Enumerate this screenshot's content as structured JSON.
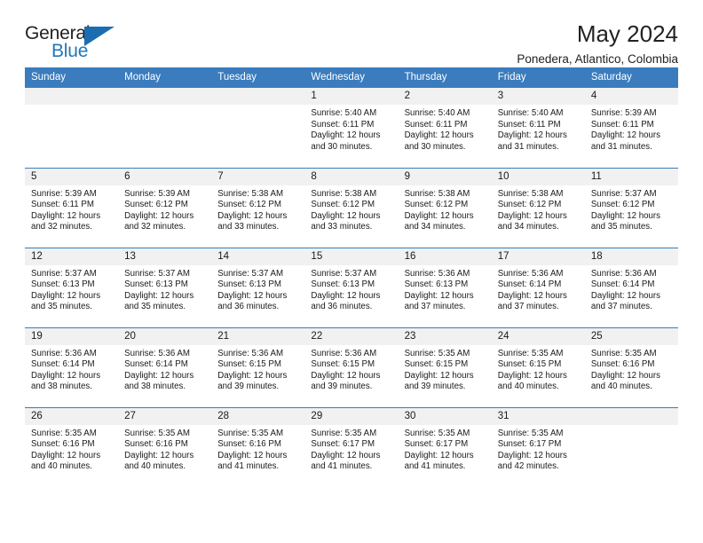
{
  "brand": {
    "word_one": "General",
    "word_two": "Blue",
    "triangle_icon": "triangle-icon"
  },
  "header": {
    "title": "May 2024",
    "location": "Ponedera, Atlantico, Colombia"
  },
  "colors": {
    "header_blue": "#3a7cbe",
    "brand_blue": "#2077bc",
    "daynum_gray": "#f1f1f1"
  },
  "weekday_headers": [
    "Sunday",
    "Monday",
    "Tuesday",
    "Wednesday",
    "Thursday",
    "Friday",
    "Saturday"
  ],
  "labels": {
    "sunrise_prefix": "Sunrise:",
    "sunset_prefix": "Sunset:",
    "daylight_prefix": "Daylight:"
  },
  "weeks": [
    [
      {
        "day": "",
        "empty": true
      },
      {
        "day": "",
        "empty": true
      },
      {
        "day": "",
        "empty": true
      },
      {
        "day": "1",
        "sunrise": "Sunrise: 5:40 AM",
        "sunset": "Sunset: 6:11 PM",
        "daylight_line1": "Daylight: 12 hours",
        "daylight_line2": "and 30 minutes."
      },
      {
        "day": "2",
        "sunrise": "Sunrise: 5:40 AM",
        "sunset": "Sunset: 6:11 PM",
        "daylight_line1": "Daylight: 12 hours",
        "daylight_line2": "and 30 minutes."
      },
      {
        "day": "3",
        "sunrise": "Sunrise: 5:40 AM",
        "sunset": "Sunset: 6:11 PM",
        "daylight_line1": "Daylight: 12 hours",
        "daylight_line2": "and 31 minutes."
      },
      {
        "day": "4",
        "sunrise": "Sunrise: 5:39 AM",
        "sunset": "Sunset: 6:11 PM",
        "daylight_line1": "Daylight: 12 hours",
        "daylight_line2": "and 31 minutes."
      }
    ],
    [
      {
        "day": "5",
        "sunrise": "Sunrise: 5:39 AM",
        "sunset": "Sunset: 6:11 PM",
        "daylight_line1": "Daylight: 12 hours",
        "daylight_line2": "and 32 minutes."
      },
      {
        "day": "6",
        "sunrise": "Sunrise: 5:39 AM",
        "sunset": "Sunset: 6:12 PM",
        "daylight_line1": "Daylight: 12 hours",
        "daylight_line2": "and 32 minutes."
      },
      {
        "day": "7",
        "sunrise": "Sunrise: 5:38 AM",
        "sunset": "Sunset: 6:12 PM",
        "daylight_line1": "Daylight: 12 hours",
        "daylight_line2": "and 33 minutes."
      },
      {
        "day": "8",
        "sunrise": "Sunrise: 5:38 AM",
        "sunset": "Sunset: 6:12 PM",
        "daylight_line1": "Daylight: 12 hours",
        "daylight_line2": "and 33 minutes."
      },
      {
        "day": "9",
        "sunrise": "Sunrise: 5:38 AM",
        "sunset": "Sunset: 6:12 PM",
        "daylight_line1": "Daylight: 12 hours",
        "daylight_line2": "and 34 minutes."
      },
      {
        "day": "10",
        "sunrise": "Sunrise: 5:38 AM",
        "sunset": "Sunset: 6:12 PM",
        "daylight_line1": "Daylight: 12 hours",
        "daylight_line2": "and 34 minutes."
      },
      {
        "day": "11",
        "sunrise": "Sunrise: 5:37 AM",
        "sunset": "Sunset: 6:12 PM",
        "daylight_line1": "Daylight: 12 hours",
        "daylight_line2": "and 35 minutes."
      }
    ],
    [
      {
        "day": "12",
        "sunrise": "Sunrise: 5:37 AM",
        "sunset": "Sunset: 6:13 PM",
        "daylight_line1": "Daylight: 12 hours",
        "daylight_line2": "and 35 minutes."
      },
      {
        "day": "13",
        "sunrise": "Sunrise: 5:37 AM",
        "sunset": "Sunset: 6:13 PM",
        "daylight_line1": "Daylight: 12 hours",
        "daylight_line2": "and 35 minutes."
      },
      {
        "day": "14",
        "sunrise": "Sunrise: 5:37 AM",
        "sunset": "Sunset: 6:13 PM",
        "daylight_line1": "Daylight: 12 hours",
        "daylight_line2": "and 36 minutes."
      },
      {
        "day": "15",
        "sunrise": "Sunrise: 5:37 AM",
        "sunset": "Sunset: 6:13 PM",
        "daylight_line1": "Daylight: 12 hours",
        "daylight_line2": "and 36 minutes."
      },
      {
        "day": "16",
        "sunrise": "Sunrise: 5:36 AM",
        "sunset": "Sunset: 6:13 PM",
        "daylight_line1": "Daylight: 12 hours",
        "daylight_line2": "and 37 minutes."
      },
      {
        "day": "17",
        "sunrise": "Sunrise: 5:36 AM",
        "sunset": "Sunset: 6:14 PM",
        "daylight_line1": "Daylight: 12 hours",
        "daylight_line2": "and 37 minutes."
      },
      {
        "day": "18",
        "sunrise": "Sunrise: 5:36 AM",
        "sunset": "Sunset: 6:14 PM",
        "daylight_line1": "Daylight: 12 hours",
        "daylight_line2": "and 37 minutes."
      }
    ],
    [
      {
        "day": "19",
        "sunrise": "Sunrise: 5:36 AM",
        "sunset": "Sunset: 6:14 PM",
        "daylight_line1": "Daylight: 12 hours",
        "daylight_line2": "and 38 minutes."
      },
      {
        "day": "20",
        "sunrise": "Sunrise: 5:36 AM",
        "sunset": "Sunset: 6:14 PM",
        "daylight_line1": "Daylight: 12 hours",
        "daylight_line2": "and 38 minutes."
      },
      {
        "day": "21",
        "sunrise": "Sunrise: 5:36 AM",
        "sunset": "Sunset: 6:15 PM",
        "daylight_line1": "Daylight: 12 hours",
        "daylight_line2": "and 39 minutes."
      },
      {
        "day": "22",
        "sunrise": "Sunrise: 5:36 AM",
        "sunset": "Sunset: 6:15 PM",
        "daylight_line1": "Daylight: 12 hours",
        "daylight_line2": "and 39 minutes."
      },
      {
        "day": "23",
        "sunrise": "Sunrise: 5:35 AM",
        "sunset": "Sunset: 6:15 PM",
        "daylight_line1": "Daylight: 12 hours",
        "daylight_line2": "and 39 minutes."
      },
      {
        "day": "24",
        "sunrise": "Sunrise: 5:35 AM",
        "sunset": "Sunset: 6:15 PM",
        "daylight_line1": "Daylight: 12 hours",
        "daylight_line2": "and 40 minutes."
      },
      {
        "day": "25",
        "sunrise": "Sunrise: 5:35 AM",
        "sunset": "Sunset: 6:16 PM",
        "daylight_line1": "Daylight: 12 hours",
        "daylight_line2": "and 40 minutes."
      }
    ],
    [
      {
        "day": "26",
        "sunrise": "Sunrise: 5:35 AM",
        "sunset": "Sunset: 6:16 PM",
        "daylight_line1": "Daylight: 12 hours",
        "daylight_line2": "and 40 minutes."
      },
      {
        "day": "27",
        "sunrise": "Sunrise: 5:35 AM",
        "sunset": "Sunset: 6:16 PM",
        "daylight_line1": "Daylight: 12 hours",
        "daylight_line2": "and 40 minutes."
      },
      {
        "day": "28",
        "sunrise": "Sunrise: 5:35 AM",
        "sunset": "Sunset: 6:16 PM",
        "daylight_line1": "Daylight: 12 hours",
        "daylight_line2": "and 41 minutes."
      },
      {
        "day": "29",
        "sunrise": "Sunrise: 5:35 AM",
        "sunset": "Sunset: 6:17 PM",
        "daylight_line1": "Daylight: 12 hours",
        "daylight_line2": "and 41 minutes."
      },
      {
        "day": "30",
        "sunrise": "Sunrise: 5:35 AM",
        "sunset": "Sunset: 6:17 PM",
        "daylight_line1": "Daylight: 12 hours",
        "daylight_line2": "and 41 minutes."
      },
      {
        "day": "31",
        "sunrise": "Sunrise: 5:35 AM",
        "sunset": "Sunset: 6:17 PM",
        "daylight_line1": "Daylight: 12 hours",
        "daylight_line2": "and 42 minutes."
      },
      {
        "day": "",
        "empty": true
      }
    ]
  ]
}
